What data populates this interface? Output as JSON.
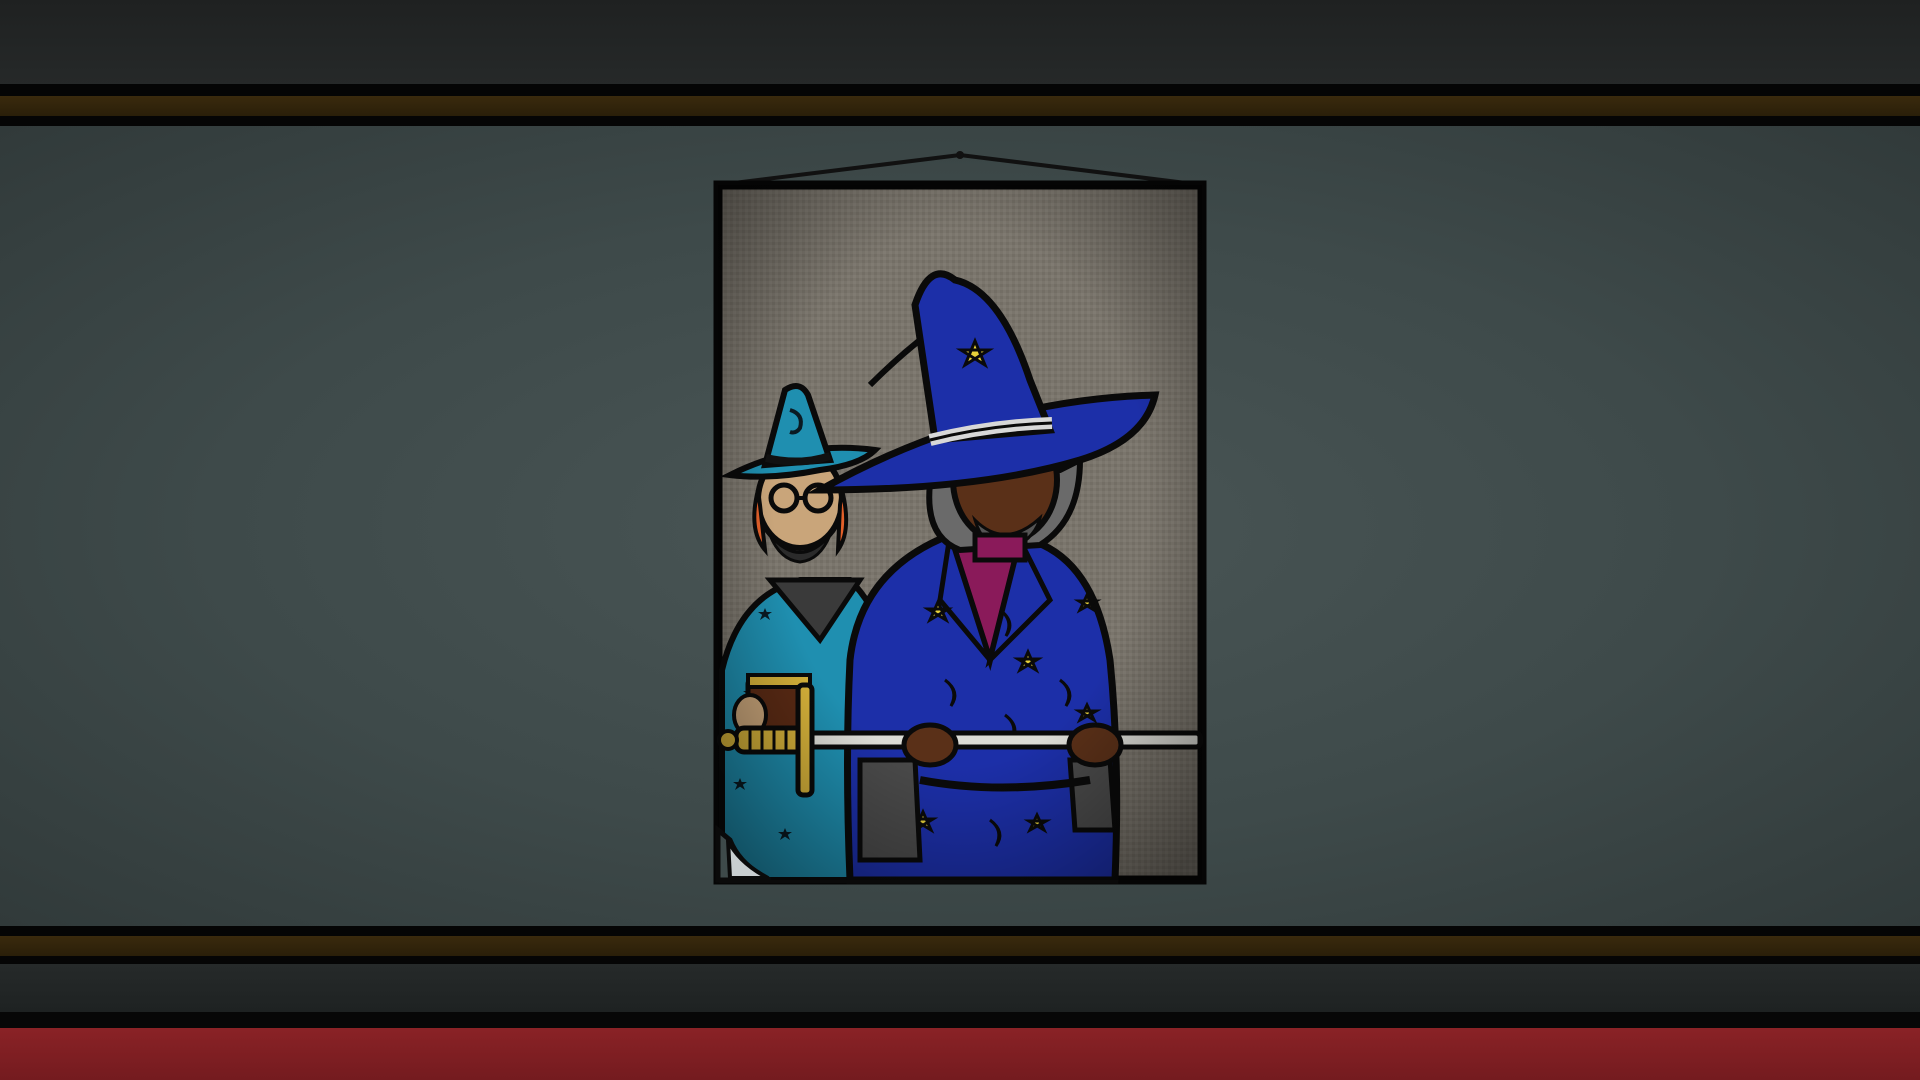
{
  "scene": {
    "subject": "wizard-poster",
    "colors": {
      "wall": "#3e4a4a",
      "ceiling": "#222525",
      "trim_brown": "#3a2a0d",
      "carpet": "#7e1e22",
      "poster_bg": "#7a756c",
      "big_wizard_robe": "#1c2fa8",
      "small_wizard_robe": "#1f8fb0",
      "star_yellow": "#e8d23a"
    }
  }
}
